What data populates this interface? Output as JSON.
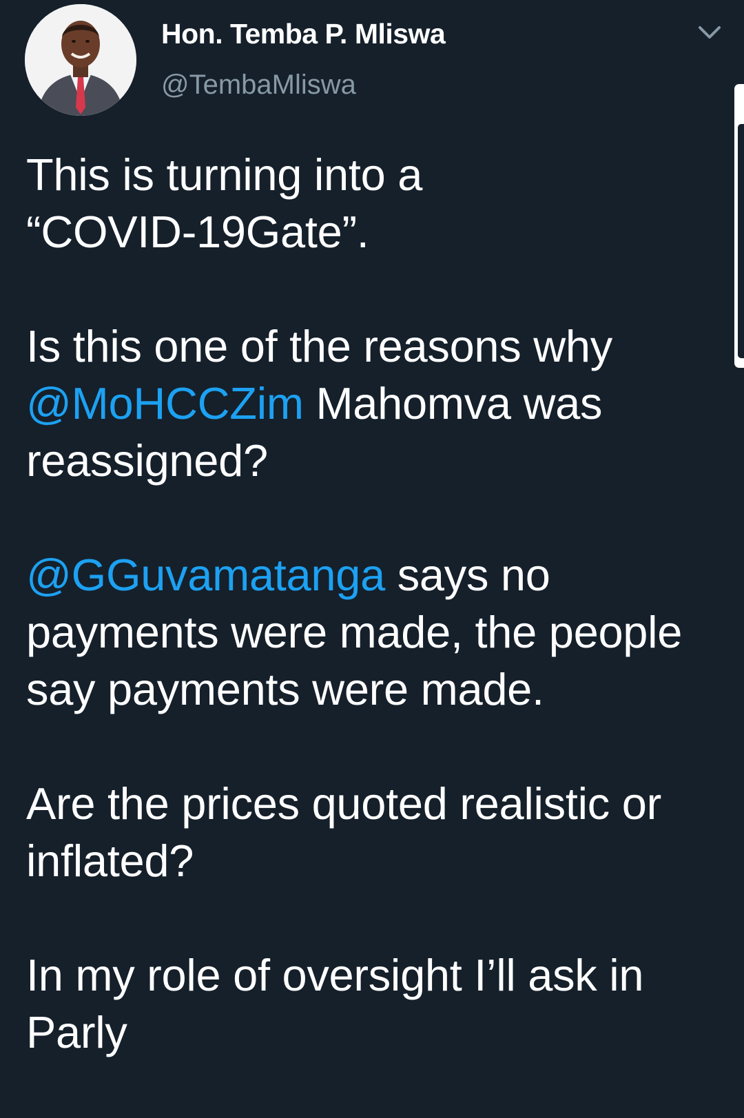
{
  "author": {
    "display_name": "Hon. Temba P. Mliswa",
    "handle": "@TembaMliswa"
  },
  "tweet": {
    "p1_l1": "This is turning into a",
    "p1_l2": "“COVID-19Gate”.",
    "p2_l1": "Is this one of the reasons why",
    "p2_mention": "@MoHCCZim",
    "p2_l2_rest": " Mahomva was",
    "p2_l3": "reassigned?",
    "p3_mention": "@GGuvamatanga",
    "p3_l1_rest": " says no",
    "p3_l2": "payments were made, the people",
    "p3_l3": "say payments were made.",
    "p4_l1": "Are the prices quoted realistic or",
    "p4_l2": "inflated?",
    "p5_l1": "In my role of oversight I’ll ask in",
    "p5_l2": "Parly"
  },
  "icons": {
    "menu": "chevron-down-icon"
  },
  "colors": {
    "background": "#15202b",
    "text": "#ffffff",
    "secondary_text": "#8899a6",
    "mention": "#1da1f2"
  }
}
